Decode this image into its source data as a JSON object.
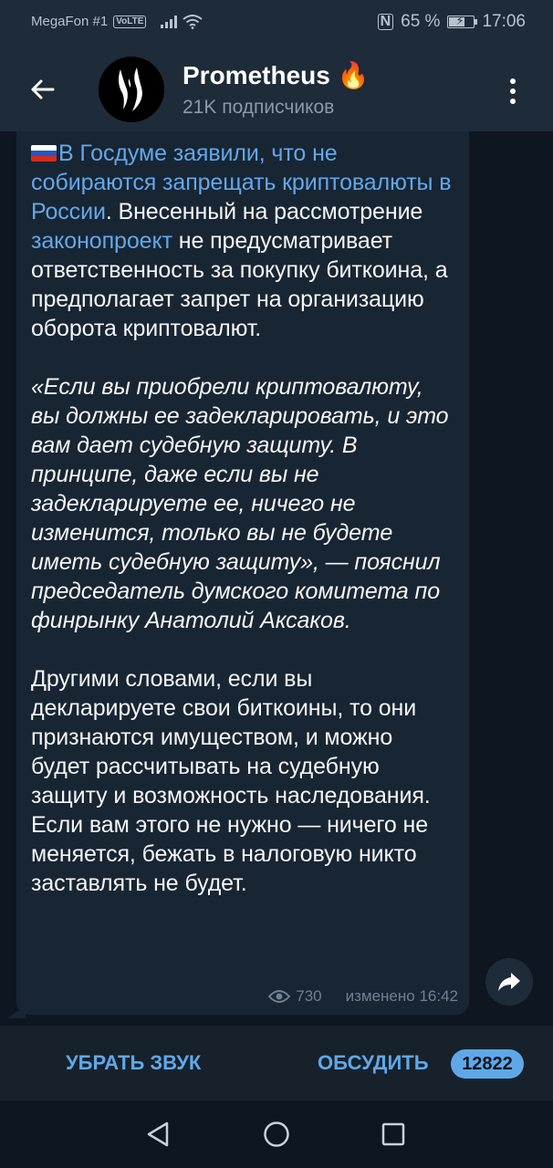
{
  "status": {
    "carrier": "MegaFon #1",
    "volte": "VoLTE",
    "battery_percent": "65 %",
    "battery_level": 0.65,
    "time": "17:06",
    "nfc": "N"
  },
  "header": {
    "title": "Prometheus",
    "title_emoji": "🔥",
    "subscribers": "21K подписчиков"
  },
  "message": {
    "intro_link": "В Госдуме заявили, что не собираются запрещать криптовалюты в России",
    "intro_end": ".",
    "p1_pre": " Внесенный на рассмотрение ",
    "p1_link": "законопроект",
    "p1_post": " не предусматривает ответственность за покупку биткоина, а предполагает запрет на организацию оборота криптовалют.",
    "quote": "«Если вы приобрели криптовалюту, вы должны ее задекларировать, и это вам дает судебную защиту. В принципе, даже если вы не задекларируете ее, ничего не изменится, только вы не будете иметь судебную защиту», — пояснил председатель думского комитета по финрынку Анатолий Аксаков.",
    "p3": "Другими словами, если вы декларируете свои биткоины, то они признаются имуществом, и можно будет рассчитывать на судебную защиту и возможность наследования. Если вам этого не нужно — ничего не меняется, бежать в налоговую никто заставлять не будет.",
    "views": "730",
    "edited": "изменено 16:42"
  },
  "bottom": {
    "mute_label": "УБРАТЬ ЗВУК",
    "discuss_label": "ОБСУДИТЬ",
    "discuss_count": "12822"
  },
  "colors": {
    "accent": "#5fa8e8",
    "link": "#62a8ea",
    "bubble": "#182533",
    "header": "#1e2b38",
    "chat_bg": "#0e1621"
  },
  "icons": {
    "back": "arrow-left-icon",
    "menu": "more-vertical-icon",
    "share": "share-forward-icon",
    "views": "eye-icon",
    "flag": "russia-flag-icon"
  }
}
